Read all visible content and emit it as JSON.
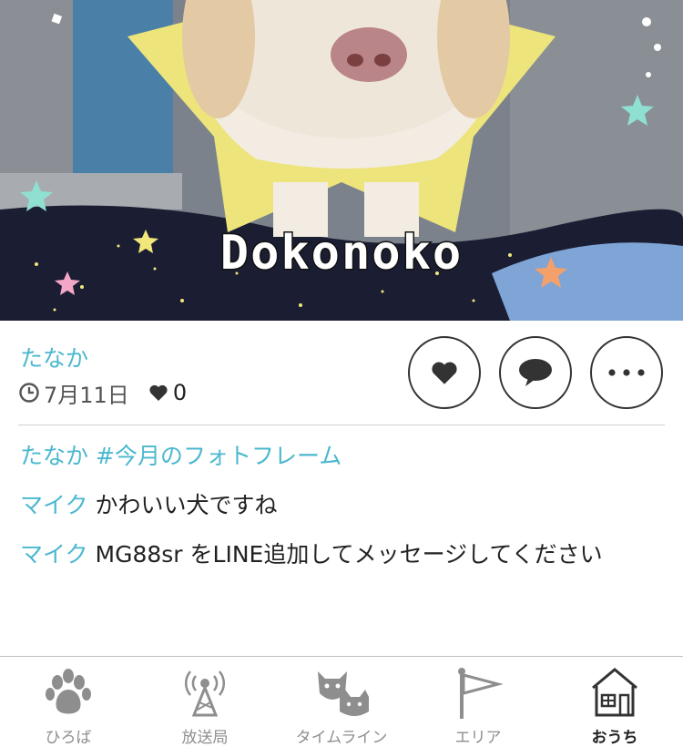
{
  "photo": {
    "caption": "Dokonoko"
  },
  "post": {
    "author": "たなか",
    "date": "7月11日",
    "like_count": "0",
    "actions": [
      "like",
      "comment",
      "more"
    ]
  },
  "comments": [
    {
      "user": "たなか",
      "text": "",
      "tag": "#今月のフォトフレーム"
    },
    {
      "user": "マイク",
      "text": "かわいい犬ですね",
      "tag": ""
    },
    {
      "user": "マイク",
      "text": "MG88sr をLINE追加してメッセージしてください",
      "tag": ""
    }
  ],
  "tabbar": {
    "items": [
      {
        "label": "ひろば",
        "icon": "paw-icon"
      },
      {
        "label": "放送局",
        "icon": "broadcast-tower-icon"
      },
      {
        "label": "タイムライン",
        "icon": "dog-cat-icon"
      },
      {
        "label": "エリア",
        "icon": "flag-icon"
      },
      {
        "label": "おうち",
        "icon": "house-icon"
      }
    ],
    "active_index": 4
  },
  "colors": {
    "accent": "#4bb8cf",
    "star_frame": "#ede47c",
    "sky": "#1b1e33"
  }
}
